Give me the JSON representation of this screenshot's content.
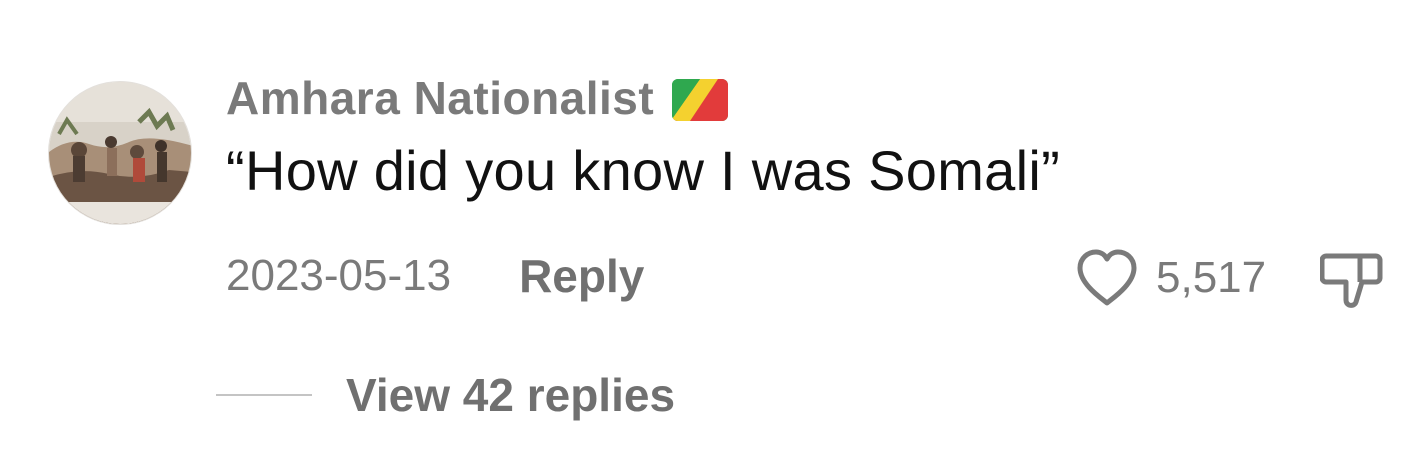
{
  "comment": {
    "username": "Amhara Nationalist",
    "flag": "congo-flag-icon",
    "text": "“How did you know I was Somali”",
    "date": "2023-05-13",
    "reply_label": "Reply",
    "like_count": "5,517",
    "view_replies_label": "View 42 replies"
  },
  "colors": {
    "username": "#7a7a7a",
    "text": "#111111",
    "secondary": "#707070",
    "flag_green": "#2fa84f",
    "flag_yellow": "#f4d12f",
    "flag_red": "#e23b3b"
  }
}
